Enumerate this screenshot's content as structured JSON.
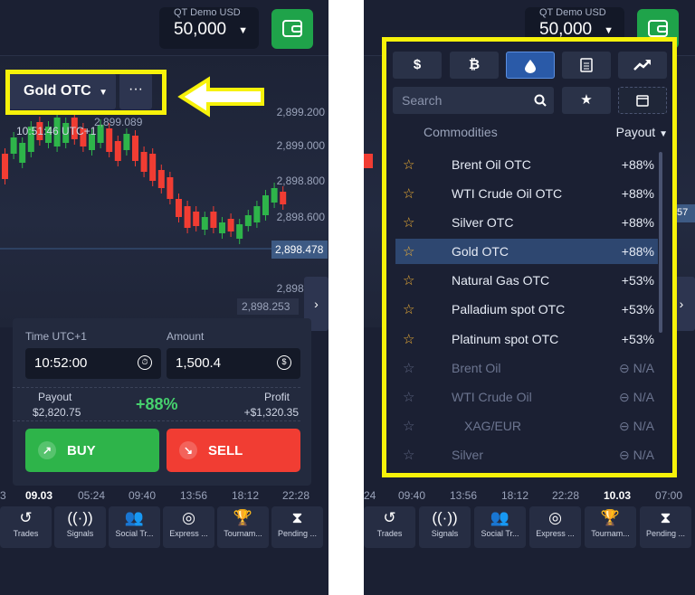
{
  "left": {
    "account": {
      "label": "QT Demo  USD",
      "balance": "50,000"
    },
    "symbol": {
      "name": "Gold OTC",
      "more": "···"
    },
    "price_labels": [
      "2,899.200",
      "2,899.000",
      "2,898.800",
      "2,898.600",
      "2,898.400",
      "2,898.200"
    ],
    "price_marker": "2,899.089",
    "current_price": "2,898.478",
    "low_price": "2,898.253",
    "clock": "10:51:46 UTC+1",
    "trade": {
      "time_label": "Time UTC+1",
      "time_value": "10:52:00",
      "amount_label": "Amount",
      "amount_value": "1,500.4",
      "payout_label": "Payout",
      "payout_value": "$2,820.75",
      "payout_pct": "+88%",
      "profit_label": "Profit",
      "profit_value": "+$1,320.35",
      "buy": "BUY",
      "sell": "SELL"
    },
    "time_axis": [
      "3",
      "09.03",
      "05:24",
      "09:40",
      "13:56",
      "18:12",
      "22:28"
    ]
  },
  "right": {
    "account": {
      "label": "QT Demo  USD",
      "balance": "50,000"
    },
    "tabs": [
      "$",
      "₿",
      "💧",
      "📄",
      "📈"
    ],
    "search_placeholder": "Search",
    "category": "Commodities",
    "sort": "Payout",
    "side_value": "57",
    "assets": [
      {
        "name": "Brent Oil OTC",
        "payout": "+88%"
      },
      {
        "name": "WTI Crude Oil OTC",
        "payout": "+88%"
      },
      {
        "name": "Silver OTC",
        "payout": "+88%"
      },
      {
        "name": "Gold OTC",
        "payout": "+88%"
      },
      {
        "name": "Natural Gas OTC",
        "payout": "+53%"
      },
      {
        "name": "Palladium spot OTC",
        "payout": "+53%"
      },
      {
        "name": "Platinum spot OTC",
        "payout": "+53%"
      },
      {
        "name": "Brent Oil",
        "payout": "N/A"
      },
      {
        "name": "WTI Crude Oil",
        "payout": "N/A"
      },
      {
        "name": "XAG/EUR",
        "payout": "N/A"
      },
      {
        "name": "Silver",
        "payout": "N/A"
      }
    ],
    "time_axis": [
      "24",
      "09:40",
      "13:56",
      "18:12",
      "22:28",
      "10.03",
      "07:00"
    ]
  },
  "nav": [
    "Trades",
    "Signals",
    "Social Tr...",
    "Express ...",
    "Tournam...",
    "Pending ..."
  ],
  "highlight_color": "#f7f20a",
  "buy_color": "#2eb44a",
  "sell_color": "#f13d33"
}
